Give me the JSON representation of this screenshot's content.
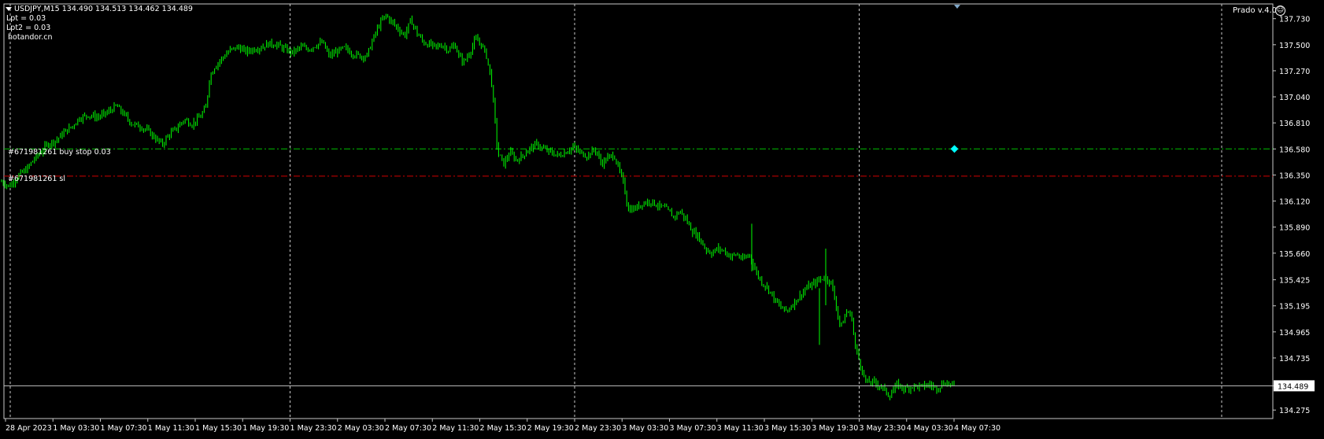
{
  "header": {
    "symbol_line": "USDJPY,M15  134.490 134.513 134.462 134.489",
    "lpt_line": "Lpt = 0.03",
    "lpt2_line": "Lpt2 = 0.03",
    "site_line": "hotandor.cn",
    "ea_name": "Prado v.4.0",
    "smiley_glyph": "☺"
  },
  "orders": {
    "buystop_label": "#671981261 buy stop 0.03",
    "sl_label": "#671981261 sl"
  },
  "colors": {
    "background": "#000000",
    "candle": "#00ff00",
    "grid": "#c8c8c8",
    "axis": "#c8c8c8",
    "buy_stop_line": "#00c000",
    "sl_line": "#d00000",
    "bid_line": "#c0c0c0",
    "marker": "#00ffff"
  },
  "chart_data": {
    "type": "candlestick",
    "symbol": "USDJPY",
    "timeframe": "M15",
    "ylim": [
      134.2,
      137.86
    ],
    "y_ticks": [
      "137.730",
      "137.500",
      "137.270",
      "137.040",
      "136.810",
      "136.580",
      "136.350",
      "136.120",
      "135.890",
      "135.660",
      "135.425",
      "135.195",
      "134.965",
      "134.735",
      "134.489",
      "134.275"
    ],
    "current_price": "134.489",
    "buy_stop_price": 136.58,
    "sl_price": 136.34,
    "x_ticks": [
      "28 Apr 2023",
      "1 May 03:30",
      "1 May 07:30",
      "1 May 11:30",
      "1 May 15:30",
      "1 May 19:30",
      "1 May 23:30",
      "2 May 03:30",
      "2 May 07:30",
      "2 May 11:30",
      "2 May 15:30",
      "2 May 19:30",
      "2 May 23:30",
      "3 May 03:30",
      "3 May 07:30",
      "3 May 11:30",
      "3 May 15:30",
      "3 May 19:30",
      "3 May 23:30",
      "4 May 03:30",
      "4 May 07:30"
    ],
    "vertical_grid_after_ticks": [
      "1 May 23:30",
      "2 May 23:30",
      "3 May 23:30"
    ],
    "price_path": [
      [
        0,
        136.3
      ],
      [
        12,
        136.25
      ],
      [
        24,
        136.35
      ],
      [
        34,
        136.4
      ],
      [
        42,
        136.48
      ],
      [
        52,
        136.55
      ],
      [
        60,
        136.62
      ],
      [
        72,
        136.66
      ],
      [
        82,
        136.73
      ],
      [
        92,
        136.78
      ],
      [
        100,
        136.85
      ],
      [
        112,
        136.88
      ],
      [
        124,
        136.86
      ],
      [
        136,
        136.9
      ],
      [
        148,
        136.96
      ],
      [
        158,
        136.88
      ],
      [
        168,
        136.8
      ],
      [
        178,
        136.78
      ],
      [
        188,
        136.74
      ],
      [
        198,
        136.67
      ],
      [
        206,
        136.62
      ],
      [
        214,
        136.7
      ],
      [
        224,
        136.76
      ],
      [
        234,
        136.84
      ],
      [
        244,
        136.8
      ],
      [
        254,
        136.86
      ],
      [
        262,
        136.95
      ],
      [
        266,
        137.2
      ],
      [
        272,
        137.3
      ],
      [
        282,
        137.38
      ],
      [
        292,
        137.45
      ],
      [
        302,
        137.48
      ],
      [
        312,
        137.44
      ],
      [
        322,
        137.46
      ],
      [
        332,
        137.48
      ],
      [
        342,
        137.51
      ],
      [
        352,
        137.5
      ],
      [
        362,
        137.46
      ],
      [
        372,
        137.43
      ],
      [
        382,
        137.48
      ],
      [
        392,
        137.46
      ],
      [
        402,
        137.5
      ],
      [
        410,
        137.52
      ],
      [
        418,
        137.4
      ],
      [
        428,
        137.44
      ],
      [
        438,
        137.47
      ],
      [
        448,
        137.42
      ],
      [
        458,
        137.4
      ],
      [
        466,
        137.4
      ],
      [
        474,
        137.55
      ],
      [
        482,
        137.68
      ],
      [
        490,
        137.76
      ],
      [
        498,
        137.7
      ],
      [
        506,
        137.64
      ],
      [
        514,
        137.58
      ],
      [
        522,
        137.72
      ],
      [
        530,
        137.6
      ],
      [
        538,
        137.52
      ],
      [
        546,
        137.5
      ],
      [
        554,
        137.48
      ],
      [
        562,
        137.5
      ],
      [
        570,
        137.45
      ],
      [
        578,
        137.5
      ],
      [
        584,
        137.38
      ],
      [
        590,
        137.35
      ],
      [
        598,
        137.45
      ],
      [
        604,
        137.55
      ],
      [
        612,
        137.5
      ],
      [
        618,
        137.4
      ],
      [
        624,
        137.2
      ],
      [
        628,
        136.9
      ],
      [
        632,
        136.55
      ],
      [
        640,
        136.45
      ],
      [
        648,
        136.55
      ],
      [
        656,
        136.48
      ],
      [
        664,
        136.52
      ],
      [
        672,
        136.58
      ],
      [
        682,
        136.62
      ],
      [
        690,
        136.58
      ],
      [
        700,
        136.55
      ],
      [
        710,
        136.52
      ],
      [
        720,
        136.56
      ],
      [
        728,
        136.6
      ],
      [
        736,
        136.55
      ],
      [
        746,
        136.52
      ],
      [
        756,
        136.58
      ],
      [
        764,
        136.45
      ],
      [
        772,
        136.5
      ],
      [
        780,
        136.53
      ],
      [
        786,
        136.4
      ],
      [
        792,
        136.28
      ],
      [
        798,
        136.05
      ],
      [
        806,
        136.05
      ],
      [
        816,
        136.1
      ],
      [
        826,
        136.12
      ],
      [
        836,
        136.08
      ],
      [
        846,
        136.05
      ],
      [
        856,
        135.98
      ],
      [
        864,
        136.03
      ],
      [
        872,
        135.95
      ],
      [
        880,
        135.85
      ],
      [
        888,
        135.8
      ],
      [
        896,
        135.7
      ],
      [
        904,
        135.66
      ],
      [
        912,
        135.7
      ],
      [
        920,
        135.68
      ],
      [
        928,
        135.63
      ],
      [
        936,
        135.65
      ],
      [
        944,
        135.6
      ],
      [
        952,
        135.65
      ],
      [
        960,
        135.5
      ],
      [
        968,
        135.4
      ],
      [
        976,
        135.35
      ],
      [
        984,
        135.25
      ],
      [
        992,
        135.18
      ],
      [
        1000,
        135.15
      ],
      [
        1008,
        135.22
      ],
      [
        1016,
        135.28
      ],
      [
        1024,
        135.35
      ],
      [
        1032,
        135.38
      ],
      [
        1040,
        135.42
      ],
      [
        1048,
        135.45
      ],
      [
        1056,
        135.4
      ],
      [
        1062,
        135.2
      ],
      [
        1068,
        135.0
      ],
      [
        1076,
        135.15
      ],
      [
        1082,
        135.1
      ],
      [
        1086,
        134.85
      ],
      [
        1092,
        134.7
      ],
      [
        1100,
        134.52
      ],
      [
        1110,
        134.52
      ],
      [
        1120,
        134.48
      ],
      [
        1130,
        134.4
      ],
      [
        1140,
        134.5
      ],
      [
        1150,
        134.46
      ],
      [
        1160,
        134.49
      ],
      [
        1170,
        134.48
      ],
      [
        1180,
        134.5
      ],
      [
        1190,
        134.47
      ],
      [
        1200,
        134.52
      ],
      [
        1208,
        134.5
      ],
      [
        1213,
        134.489
      ]
    ]
  }
}
